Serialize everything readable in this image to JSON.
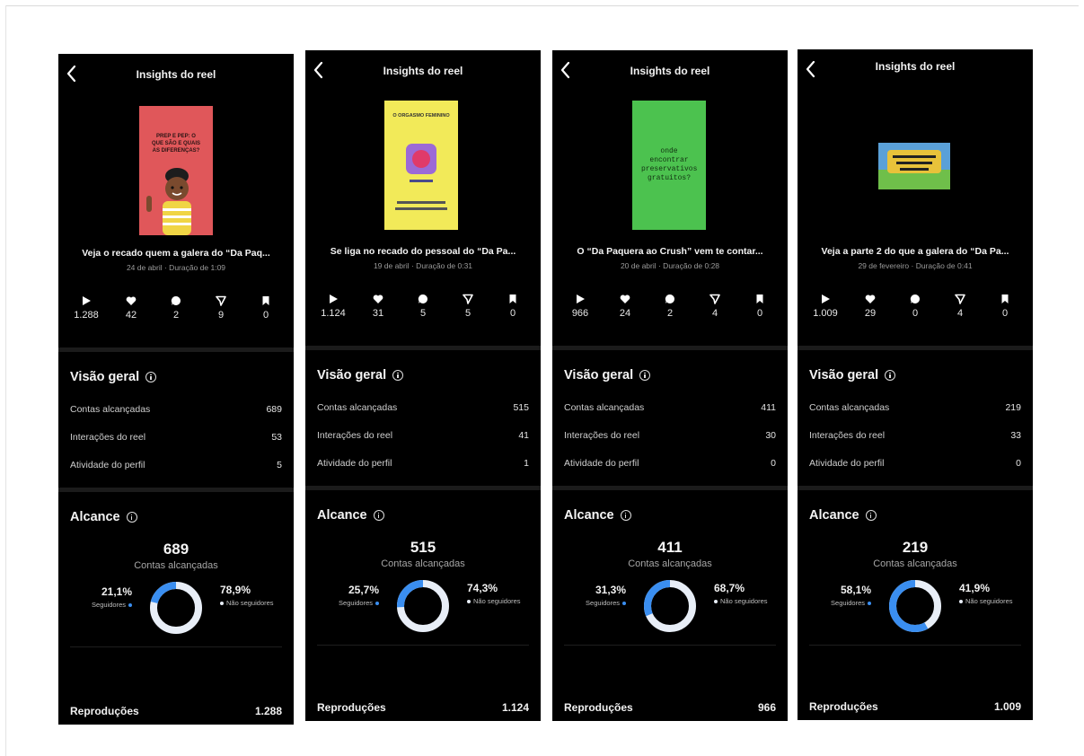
{
  "panels": [
    {
      "header": "Insights do reel",
      "thumb": {
        "bg": "#e0575a",
        "text": "PREP E PEP: O QUE SÃO E QUAIS AS DIFERENÇAS?"
      },
      "reel_title": "Veja o recado quem a galera do “Da Paq...",
      "meta": "24 de abril · Duração de 1:09",
      "stats": {
        "plays": "1.288",
        "likes": "42",
        "comments": "2",
        "shares": "9",
        "saves": "0"
      },
      "overview_title": "Visão geral",
      "rows": [
        {
          "label": "Contas alcançadas",
          "value": "689"
        },
        {
          "label": "Interações do reel",
          "value": "53"
        },
        {
          "label": "Atividade do perfil",
          "value": "5"
        }
      ],
      "reach_title": "Alcance",
      "reach_number": "689",
      "reach_label": "Contas alcançadas",
      "followers_pct": "21,1%",
      "followers_fraction": 0.211,
      "followers_label": "Seguidores",
      "non_followers_pct": "78,9%",
      "non_followers_label": "Não seguidores",
      "plays_label": "Reproduções",
      "plays_value": "1.288"
    },
    {
      "header": "Insights do reel",
      "thumb": {
        "bg": "#f2ea59",
        "text": "O ORGASMO FEMININO"
      },
      "reel_title": "Se liga no recado do pessoal do “Da Pa...",
      "meta": "19 de abril · Duração de 0:31",
      "stats": {
        "plays": "1.124",
        "likes": "31",
        "comments": "5",
        "shares": "5",
        "saves": "0"
      },
      "overview_title": "Visão geral",
      "rows": [
        {
          "label": "Contas alcançadas",
          "value": "515"
        },
        {
          "label": "Interações do reel",
          "value": "41"
        },
        {
          "label": "Atividade do perfil",
          "value": "1"
        }
      ],
      "reach_title": "Alcance",
      "reach_number": "515",
      "reach_label": "Contas alcançadas",
      "followers_pct": "25,7%",
      "followers_fraction": 0.257,
      "followers_label": "Seguidores",
      "non_followers_pct": "74,3%",
      "non_followers_label": "Não seguidores",
      "plays_label": "Reproduções",
      "plays_value": "1.124"
    },
    {
      "header": "Insights do reel",
      "thumb": {
        "bg": "#4cc24f",
        "text": "onde encontrar preservativos gratuitos?"
      },
      "reel_title": "O “Da Paquera ao Crush” vem te contar...",
      "meta": "20 de abril · Duração de 0:28",
      "stats": {
        "plays": "966",
        "likes": "24",
        "comments": "2",
        "shares": "4",
        "saves": "0"
      },
      "overview_title": "Visão geral",
      "rows": [
        {
          "label": "Contas alcançadas",
          "value": "411"
        },
        {
          "label": "Interações do reel",
          "value": "30"
        },
        {
          "label": "Atividade do perfil",
          "value": "0"
        }
      ],
      "reach_title": "Alcance",
      "reach_number": "411",
      "reach_label": "Contas alcançadas",
      "followers_pct": "31,3%",
      "followers_fraction": 0.313,
      "followers_label": "Seguidores",
      "non_followers_pct": "68,7%",
      "non_followers_label": "Não seguidores",
      "plays_label": "Reproduções",
      "plays_value": "966"
    },
    {
      "header": "Insights do reel",
      "thumb": {
        "bg": "#3b7fc0",
        "text": ""
      },
      "reel_title": "Veja a parte 2 do que a galera do “Da Pa...",
      "meta": "29 de fevereiro · Duração de 0:41",
      "stats": {
        "plays": "1.009",
        "likes": "29",
        "comments": "0",
        "shares": "4",
        "saves": "0"
      },
      "overview_title": "Visão geral",
      "rows": [
        {
          "label": "Contas alcançadas",
          "value": "219"
        },
        {
          "label": "Interações do reel",
          "value": "33"
        },
        {
          "label": "Atividade do perfil",
          "value": "0"
        }
      ],
      "reach_title": "Alcance",
      "reach_number": "219",
      "reach_label": "Contas alcançadas",
      "followers_pct": "58,1%",
      "followers_fraction": 0.581,
      "followers_label": "Seguidores",
      "non_followers_pct": "41,9%",
      "non_followers_label": "Não seguidores",
      "plays_label": "Reproduções",
      "plays_value": "1.009"
    }
  ],
  "colors": {
    "followers": "#3a8ef0",
    "non_followers": "#e8eef7",
    "panel_bg": "#000000"
  }
}
